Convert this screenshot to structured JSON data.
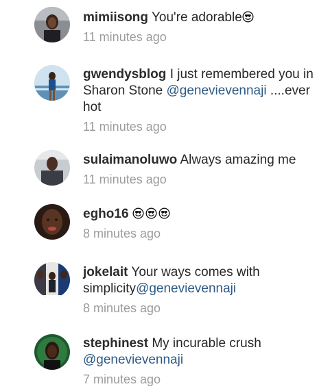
{
  "comments": [
    {
      "username": "mimiisong",
      "text": "You're adorable",
      "emoji_count": 1,
      "emoji": "heart-eyes-emoji",
      "time": "11 minutes ago"
    },
    {
      "username": "gwendysblog",
      "text": "I just remembered you in Sharon Stone",
      "mention": "@genevievennaji",
      "text_after": "....ever hot",
      "time": "11 minutes ago"
    },
    {
      "username": "sulaimanoluwo",
      "text": "Always amazing me",
      "time": "11 minutes ago"
    },
    {
      "username": "egho16",
      "emoji_count": 3,
      "emoji": "heart-eyes-emoji",
      "time": "8 minutes ago"
    },
    {
      "username": "jokelait",
      "text": "Your ways comes with simplicity",
      "mention": "@genevievennaji",
      "time": "8 minutes ago"
    },
    {
      "username": "stephinest",
      "text": "My incurable crush",
      "mention": "@genevievennaji",
      "time": "7 minutes ago"
    }
  ],
  "colors": {
    "username": "#2b2b2b",
    "text": "#262626",
    "mention": "#2d5a86",
    "timestamp": "#9c9c9c"
  }
}
